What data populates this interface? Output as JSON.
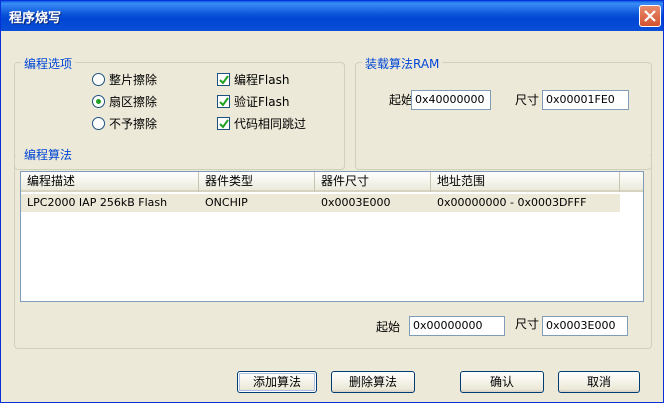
{
  "window": {
    "title": "程序烧写"
  },
  "program_options": {
    "legend": "编程选项",
    "radios": [
      {
        "label": "整片擦除",
        "checked": false
      },
      {
        "label": "扇区擦除",
        "checked": true
      },
      {
        "label": "不予擦除",
        "checked": false
      }
    ],
    "checks": [
      {
        "label": "编程Flash",
        "checked": true
      },
      {
        "label": "验证Flash",
        "checked": true
      },
      {
        "label": "代码相同跳过",
        "checked": true
      }
    ]
  },
  "load_ram": {
    "legend": "装载算法RAM",
    "start_label": "起始",
    "start_value": "0x40000000",
    "size_label": "尺寸",
    "size_value": "0x00001FE0"
  },
  "algorithm": {
    "legend": "编程算法",
    "columns": [
      "编程描述",
      "器件类型",
      "器件尺寸",
      "地址范围"
    ],
    "rows": [
      [
        "LPC2000 IAP 256kB Flash",
        "ONCHIP",
        "0x0003E000",
        "0x00000000 - 0x0003DFFF"
      ]
    ],
    "start_label": "起始",
    "start_value": "0x00000000",
    "size_label": "尺寸",
    "size_value": "0x0003E000"
  },
  "buttons": {
    "add": "添加算法",
    "remove": "删除算法",
    "ok": "确认",
    "cancel": "取消"
  }
}
